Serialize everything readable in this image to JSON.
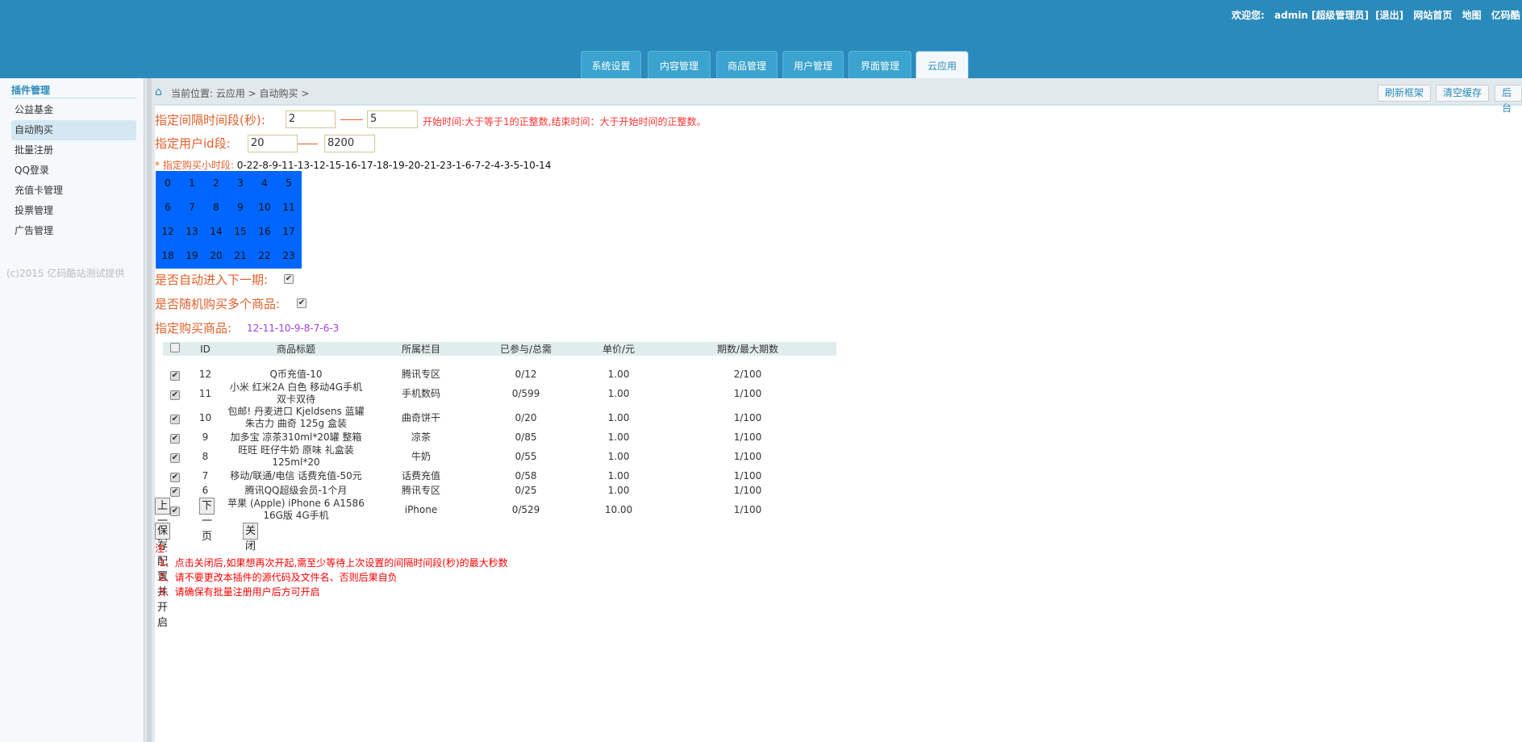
{
  "header": {
    "welcome": "欢迎您:",
    "user": "admin [超级管理员]",
    "logout": "[退出]",
    "home": "网站首页",
    "map": "地图",
    "brand": "亿码酷"
  },
  "tabs": [
    "系统设置",
    "内容管理",
    "商品管理",
    "用户管理",
    "界面管理",
    "云应用"
  ],
  "active_tab": 5,
  "sidebar": {
    "title": "插件管理",
    "items": [
      "公益基金",
      "自动购买",
      "批量注册",
      "QQ登录",
      "充值卡管理",
      "投票管理",
      "广告管理"
    ],
    "active": 1,
    "copyright": "(c)2015 亿码酷站测试提供"
  },
  "breadcrumb": "当前位置: 云应用 > 自动购买 >",
  "toolbar": {
    "refresh": "刷新框架",
    "clear_cache": "清空缓存",
    "backend": "后台"
  },
  "form": {
    "interval_label": "指定间隔时间段(秒):",
    "interval_start": "2",
    "interval_end": "5",
    "interval_hint": "开始时间:大于等于1的正整数,结束时间：大于开始时间的正整数。",
    "userid_label": "指定用户id段:",
    "userid_start": "20",
    "userid_end": "8200",
    "hours_label": "* 指定购买小时段:",
    "hours_value": "0-22-8-9-11-13-12-15-16-17-18-19-20-21-23-1-6-7-2-4-3-5-10-14",
    "hours": [
      "0",
      "1",
      "2",
      "3",
      "4",
      "5",
      "6",
      "7",
      "8",
      "9",
      "10",
      "11",
      "12",
      "13",
      "14",
      "15",
      "16",
      "17",
      "18",
      "19",
      "20",
      "21",
      "22",
      "23"
    ],
    "auto_next_label": "是否自动进入下一期:",
    "auto_next": true,
    "random_label": "是否随机购买多个商品:",
    "random": true,
    "goods_label": "指定购买商品:",
    "goods_value": "12-11-10-9-8-7-6-3"
  },
  "table": {
    "headers": [
      "ID",
      "商品标题",
      "所属栏目",
      "已参与/总需",
      "单价/元",
      "期数/最大期数"
    ],
    "rows": [
      [
        "12",
        "Q币充值-10",
        "腾讯专区",
        "0/12",
        "1.00",
        "2/100"
      ],
      [
        "11",
        "小米 红米2A 白色 移动4G手机 双卡双待",
        "手机数码",
        "0/599",
        "1.00",
        "1/100"
      ],
      [
        "10",
        "包邮! 丹麦进口 Kjeldsens 蓝罐 朱古力 曲奇 125g 盒装",
        "曲奇饼干",
        "0/20",
        "1.00",
        "1/100"
      ],
      [
        "9",
        "加多宝 凉茶310ml*20罐 整箱",
        "凉茶",
        "0/85",
        "1.00",
        "1/100"
      ],
      [
        "8",
        "旺旺 旺仔牛奶 原味 礼盒装 125ml*20",
        "牛奶",
        "0/55",
        "1.00",
        "1/100"
      ],
      [
        "7",
        "移动/联通/电信 话费充值-50元",
        "话费充值",
        "0/58",
        "1.00",
        "1/100"
      ],
      [
        "6",
        "腾讯QQ超级会员-1个月",
        "腾讯专区",
        "0/25",
        "1.00",
        "1/100"
      ],
      [
        "3",
        "苹果 (Apple) iPhone 6 A1586 16G版 4G手机",
        "iPhone",
        "0/529",
        "10.00",
        "1/100"
      ]
    ]
  },
  "pager": {
    "prev": "上一页",
    "next": "下一页"
  },
  "actions": {
    "save": "保存配置并开启",
    "close": "关闭"
  },
  "notes": {
    "title": "注:",
    "items": [
      "1、点击关闭后,如果想再次开起,需至少等待上次设置的间隔时间段(秒)的最大秒数",
      "2、请不要更改本插件的源代码及文件名、否则后果自负",
      "3、请确保有批量注册用户后方可开启"
    ]
  }
}
